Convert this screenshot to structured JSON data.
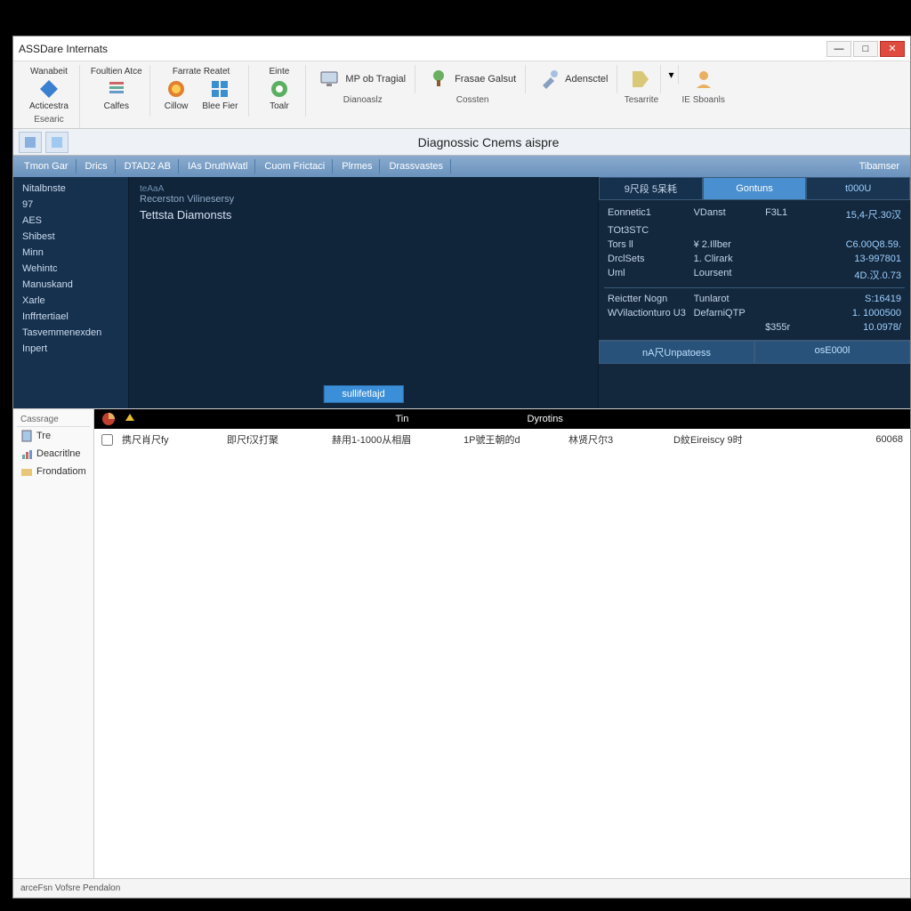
{
  "title": "ASSDare Internats",
  "ribbon": {
    "groups": [
      {
        "label": "Esearic",
        "buttons": [
          {
            "icon": "blue-document-icon",
            "label": "Acticestra"
          }
        ],
        "toplabel": "Wanabeit"
      },
      {
        "label": "",
        "buttons": [
          {
            "icon": "list-icon",
            "label": "Calfes"
          }
        ],
        "toplabel": "Foultien Atce"
      },
      {
        "label": "",
        "buttons": [
          {
            "icon": "globe-icon",
            "label": "Cillow"
          },
          {
            "icon": "grid-icon",
            "label": "Blee Fier"
          }
        ],
        "toplabel": "Farrate Reatet"
      },
      {
        "label": "",
        "buttons": [
          {
            "icon": "green-gear-icon",
            "label": "Toalr"
          }
        ],
        "toplabel": "Einte"
      }
    ],
    "wide": [
      {
        "icon": "monitor-icon",
        "label": "MP ob Tragial",
        "group": "Dianoaslz"
      },
      {
        "icon": "tree-icon",
        "label": "Frasae Galsut",
        "group": "Cossten"
      },
      {
        "icon": "tools-icon",
        "label": "Adensctel",
        "group": ""
      },
      {
        "icon": "tag-icon",
        "label": "",
        "group": "Tesarrite"
      },
      {
        "icon": "dropdown-icon",
        "label": "",
        "group": ""
      },
      {
        "icon": "person-icon",
        "label": "",
        "group": "IE Sboanls"
      }
    ]
  },
  "panel_title": "Diagnossic Cnems aispre",
  "tabs": [
    "Tmon Gar",
    "Drics",
    "DTAD2 AB",
    "IAs DruthWatl",
    "Cuom Frictaci",
    "Plrmes",
    "Drassvastes"
  ],
  "tab_right": "Tibamser",
  "side_nav": [
    "Nitalbnste",
    "97",
    "AES",
    "Shibest",
    "Minn",
    "Wehintc",
    "Manuskand",
    "Xarle",
    "Inffrtertiael",
    "Tasvemmenexden",
    "Inpert"
  ],
  "center": {
    "subtitle": "teAaA",
    "line1": "Recerston Vilinesersy",
    "line2": "Tettsta Diamonsts",
    "button": "sullifetlajd"
  },
  "right_panel": {
    "header": [
      "9尺段 5呆耗",
      "Gontuns",
      "t000U"
    ],
    "rows": [
      {
        "k": "Eonnetic1",
        "m": "VDanst",
        "v": "F3L1",
        "v2": "15,4-尺.30汉"
      },
      {
        "k": "TOt3STC",
        "m": "",
        "v": "",
        "v2": ""
      },
      {
        "k": "Tors ll",
        "m": "¥ 2.Illber",
        "v": "",
        "v2": "C6.00Q8.59."
      },
      {
        "k": "DrclSets",
        "m": "1. Clirark",
        "v": "",
        "v2": "13-997801"
      },
      {
        "k": "Uml",
        "m": "Loursent",
        "v": "",
        "v2": "4D.汉.0.73"
      }
    ],
    "rows2": [
      {
        "k": "Reictter Nogn",
        "m": "Tunlarot",
        "v": "",
        "v2": "S:16419"
      },
      {
        "k": "WVilactionturo U3",
        "m": "DefarniQTP",
        "v": "",
        "v2": "1. 1000500"
      },
      {
        "k": "",
        "m": "",
        "v": "$355r",
        "v2": "10.0978/"
      }
    ],
    "footer": [
      "nA尺Unpatoess",
      "osE000l"
    ]
  },
  "lower_left": {
    "header": "Cassrage",
    "items": [
      {
        "icon": "doc-icon",
        "label": "Tre"
      },
      {
        "icon": "chart-icon",
        "label": "Deacritlne"
      },
      {
        "icon": "folder-icon",
        "label": "Frondatiom"
      }
    ]
  },
  "lower_header": {
    "col1": "Tin",
    "col2": "Dyrotins"
  },
  "lower_rows": [
    {
      "c1": "携尺肖尺fy",
      "c2": "即尺f汉打聚",
      "c3": "赫用1-1000从相眉",
      "c4": "1P號王朝的d",
      "c5": "林贤尺尔3",
      "c6": "D紋Eireiscy  9时",
      "c7": "60068"
    }
  ],
  "statusbar": "arceFsn Vofsre   Pendalon"
}
